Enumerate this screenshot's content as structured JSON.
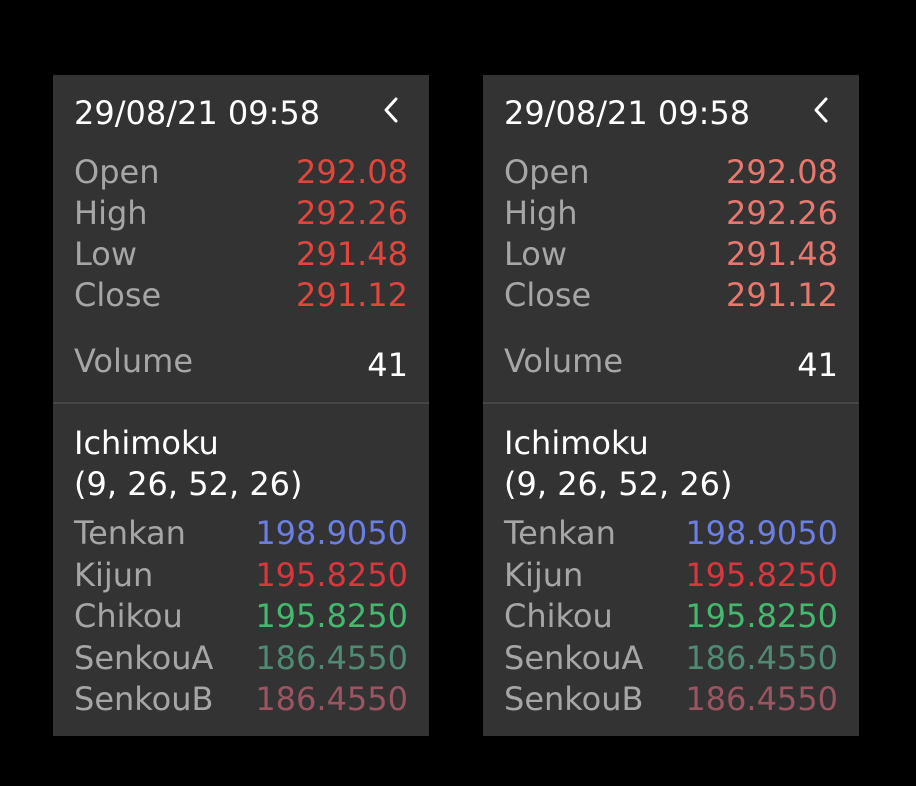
{
  "colors": {
    "background": "#000000",
    "panel": "#333333",
    "label": "#a6a6a6",
    "text": "#ffffff",
    "price_left": "#e0463c",
    "price_right": "#e8776e",
    "tenkan": "#6b7fe3",
    "kijun": "#d7373d",
    "chikou": "#45b86f",
    "senkou_a": "#4f8a73",
    "senkou_b": "#9b5562"
  },
  "panels": [
    {
      "datetime": "29/08/21 09:58",
      "collapse_icon": "chevron-left-icon",
      "ohlc": [
        {
          "label": "Open",
          "value": "292.08"
        },
        {
          "label": "High",
          "value": "292.26"
        },
        {
          "label": "Low",
          "value": "291.48"
        },
        {
          "label": "Close",
          "value": "291.12"
        }
      ],
      "volume": {
        "label": "Volume",
        "value": "41"
      },
      "indicator": {
        "title": "Ichimoku",
        "params": "(9, 26, 52, 26)",
        "lines": [
          {
            "label": "Tenkan",
            "value": "198.9050"
          },
          {
            "label": "Kijun",
            "value": "195.8250"
          },
          {
            "label": "Chikou",
            "value": "195.8250"
          },
          {
            "label": "SenkouA",
            "value": "186.4550"
          },
          {
            "label": "SenkouB",
            "value": "186.4550"
          }
        ]
      }
    },
    {
      "datetime": "29/08/21 09:58",
      "collapse_icon": "chevron-left-icon",
      "ohlc": [
        {
          "label": "Open",
          "value": "292.08"
        },
        {
          "label": "High",
          "value": "292.26"
        },
        {
          "label": "Low",
          "value": "291.48"
        },
        {
          "label": "Close",
          "value": "291.12"
        }
      ],
      "volume": {
        "label": "Volume",
        "value": "41"
      },
      "indicator": {
        "title": "Ichimoku",
        "params": "(9, 26, 52, 26)",
        "lines": [
          {
            "label": "Tenkan",
            "value": "198.9050"
          },
          {
            "label": "Kijun",
            "value": "195.8250"
          },
          {
            "label": "Chikou",
            "value": "195.8250"
          },
          {
            "label": "SenkouA",
            "value": "186.4550"
          },
          {
            "label": "SenkouB",
            "value": "186.4550"
          }
        ]
      }
    }
  ]
}
